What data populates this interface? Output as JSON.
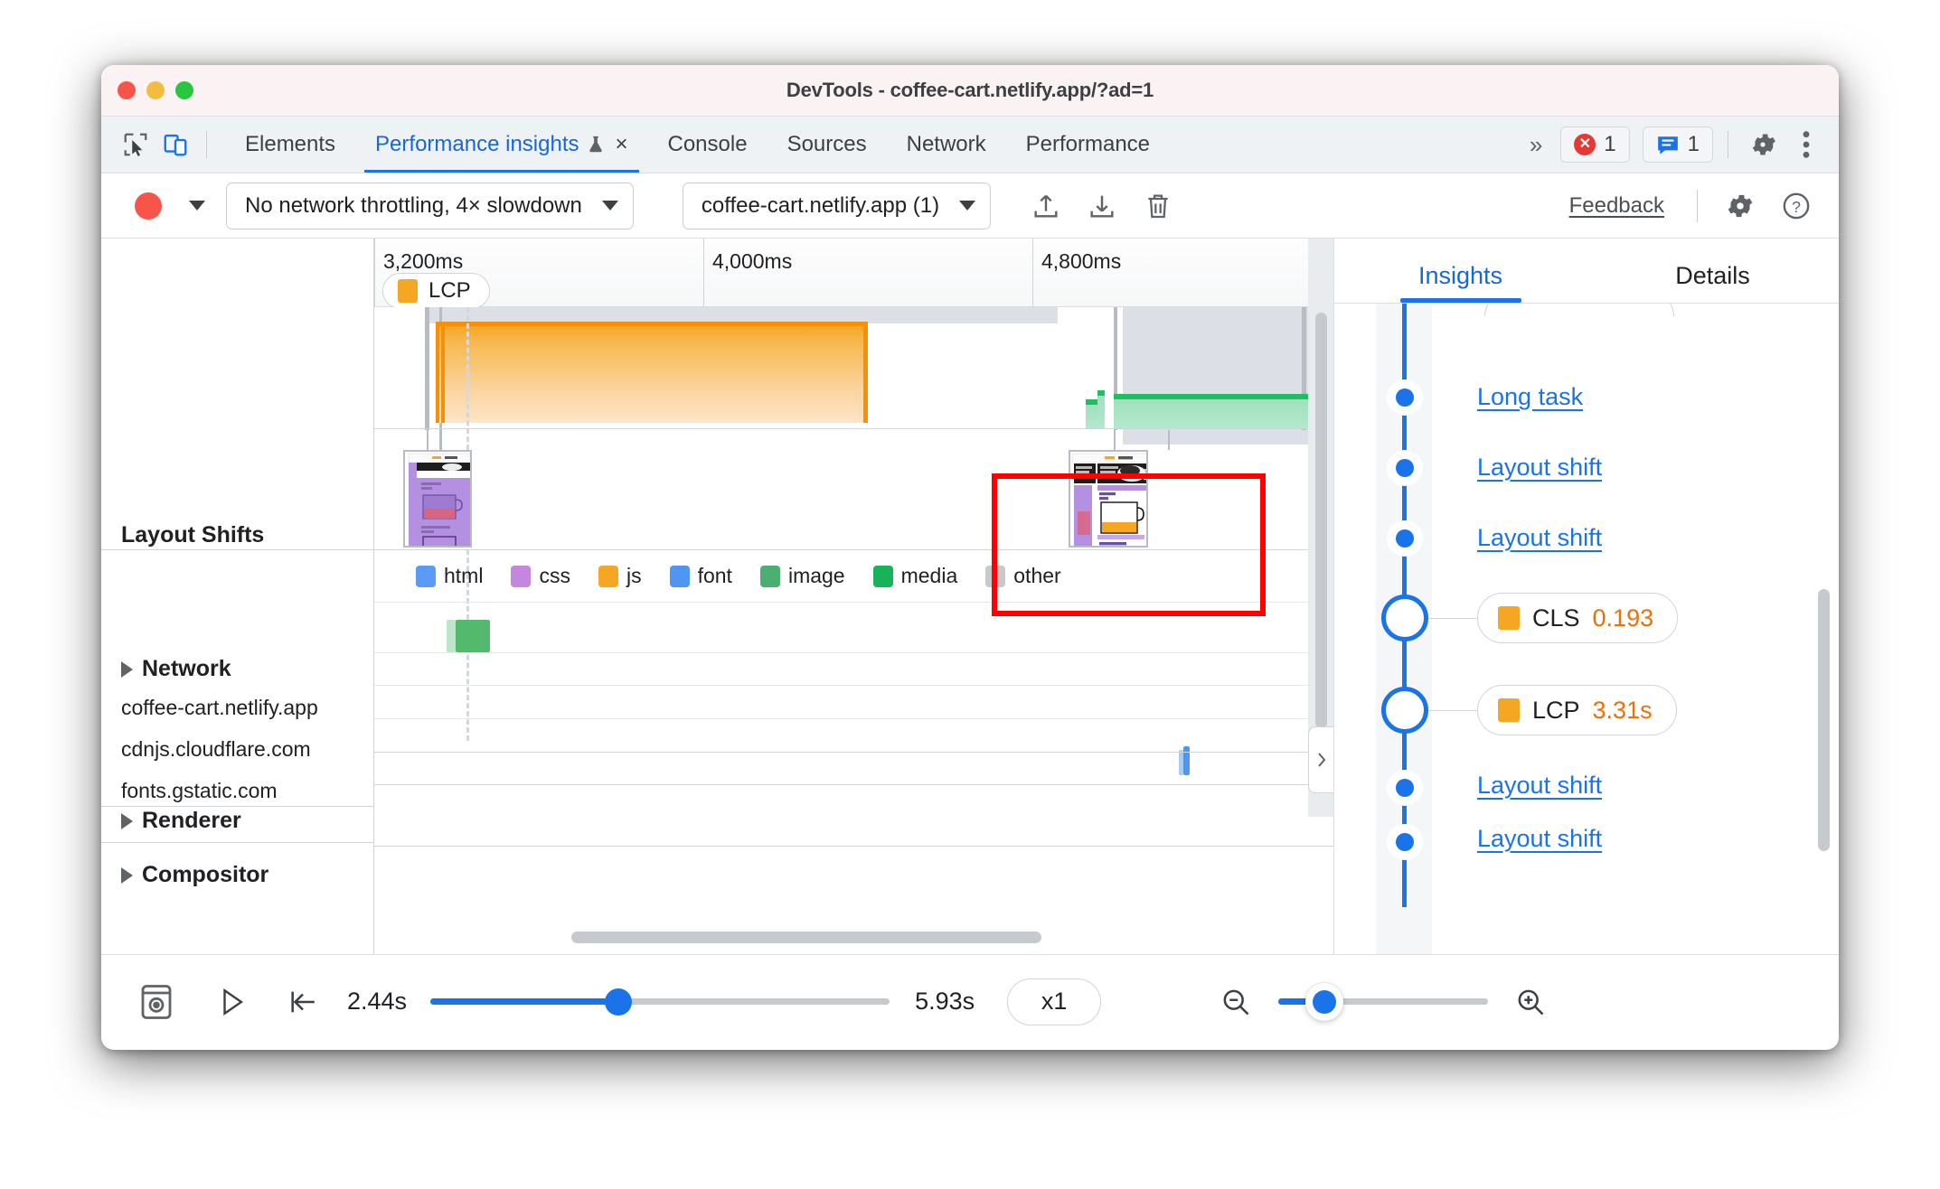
{
  "window": {
    "title": "DevTools - coffee-cart.netlify.app/?ad=1",
    "traffic_lights": [
      "close-red",
      "minimize-yellow",
      "maximize-green"
    ]
  },
  "tabbar": {
    "left_icons": [
      "inspect-element-icon",
      "device-toolbar-icon"
    ],
    "tabs": [
      {
        "label": "Elements",
        "active": false
      },
      {
        "label": "Performance insights",
        "active": true,
        "experiment_icon": "flask-icon",
        "closable": true,
        "close_label": "×"
      },
      {
        "label": "Console",
        "active": false
      },
      {
        "label": "Sources",
        "active": false
      },
      {
        "label": "Network",
        "active": false
      },
      {
        "label": "Performance",
        "active": false
      }
    ],
    "more_tabs_label": "»",
    "error_count": "1",
    "message_count": "1",
    "settings_icon": "gear-icon",
    "more_icon": "kebab-menu-icon"
  },
  "toolbar": {
    "record_icon": "record-circle-icon",
    "record_dropdown_icon": "caret-down-icon",
    "throttling": {
      "value": "No network throttling, 4× slowdown",
      "caret": "caret-down-icon"
    },
    "trace": {
      "value": "coffee-cart.netlify.app (1)",
      "caret": "caret-down-icon"
    },
    "actions": [
      "upload-icon",
      "download-icon",
      "trash-icon"
    ],
    "feedback_label": "Feedback",
    "settings_icon": "gear-icon",
    "help_icon": "help-circle-icon"
  },
  "timeline": {
    "ruler_ticks": [
      "3,200ms",
      "4,000ms",
      "4,800ms"
    ],
    "lcp_marker": {
      "label": "LCP",
      "swatch_color": "#f5a623"
    },
    "rows": [
      {
        "label": "Layout Shifts",
        "expandable": false
      },
      {
        "label": "Network",
        "expandable": true
      },
      {
        "label": "coffee-cart.netlify.app",
        "child": true
      },
      {
        "label": "cdnjs.cloudflare.com",
        "child": true
      },
      {
        "label": "fonts.gstatic.com",
        "child": true
      },
      {
        "label": "Renderer",
        "expandable": true
      },
      {
        "label": "Compositor",
        "expandable": true
      }
    ],
    "legend": [
      {
        "label": "html",
        "color": "#5b9bf5"
      },
      {
        "label": "css",
        "color": "#c387e0"
      },
      {
        "label": "js",
        "color": "#f5a623"
      },
      {
        "label": "font",
        "color": "#4d97f2"
      },
      {
        "label": "image",
        "color": "#4caf72"
      },
      {
        "label": "media",
        "color": "#18b358"
      },
      {
        "label": "other",
        "color": "#c7cacd"
      }
    ],
    "annotation": {
      "type": "red-rectangle-highlight",
      "color": "#ff0000"
    },
    "collapse_handle_icon": "chevron-right-icon"
  },
  "insights": {
    "tabs": [
      {
        "label": "Insights",
        "active": true
      },
      {
        "label": "Details",
        "active": false
      }
    ],
    "items": [
      {
        "label": "Long task",
        "kind": "link"
      },
      {
        "label": "Layout shift",
        "kind": "link"
      },
      {
        "label": "Layout shift",
        "kind": "link"
      },
      {
        "label": "CLS",
        "value": "0.193",
        "kind": "metric",
        "swatch_color": "#f5a623"
      },
      {
        "label": "LCP",
        "value": "3.31s",
        "kind": "metric",
        "swatch_color": "#f5a623"
      },
      {
        "label": "Layout shift",
        "kind": "link"
      },
      {
        "label": "Layout shift",
        "kind": "link"
      }
    ]
  },
  "bottombar": {
    "screenshot_icon": "filmstrip-icon",
    "play_icon": "play-icon",
    "jump-to-start_icon": "jump-to-start-icon",
    "start_time": "2.44s",
    "end_time": "5.93s",
    "playback_rate": "x1",
    "zoom_out_icon": "zoom-out-icon",
    "zoom_in_icon": "zoom-in-icon",
    "progress_percent": 41,
    "zoom_percent": 22
  }
}
